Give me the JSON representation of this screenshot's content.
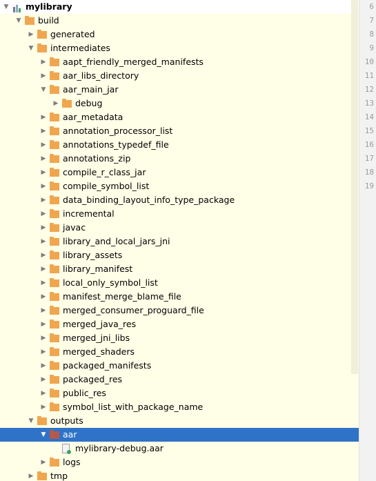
{
  "colors": {
    "tree_background": "#fffee7",
    "selection": "#2e73c8",
    "folder": "#f0a64f",
    "folder_selected": "#b5584d",
    "gutter": "#f2f2f2"
  },
  "gutter": {
    "line_numbers": [
      "6",
      "7",
      "8",
      "9",
      "10",
      "11",
      "12",
      "13",
      "14",
      "15",
      "16",
      "17",
      "18",
      "19"
    ]
  },
  "tree": [
    {
      "label": "mylibrary",
      "depth": 0,
      "expanded": true,
      "icon": "module-icon",
      "bold": true
    },
    {
      "label": "build",
      "depth": 1,
      "expanded": true,
      "icon": "folder-icon"
    },
    {
      "label": "generated",
      "depth": 2,
      "expanded": false,
      "icon": "folder-icon"
    },
    {
      "label": "intermediates",
      "depth": 2,
      "expanded": true,
      "icon": "folder-icon"
    },
    {
      "label": "aapt_friendly_merged_manifests",
      "depth": 3,
      "expanded": false,
      "icon": "folder-icon"
    },
    {
      "label": "aar_libs_directory",
      "depth": 3,
      "expanded": false,
      "icon": "folder-icon"
    },
    {
      "label": "aar_main_jar",
      "depth": 3,
      "expanded": true,
      "icon": "folder-icon"
    },
    {
      "label": "debug",
      "depth": 4,
      "expanded": false,
      "icon": "folder-icon"
    },
    {
      "label": "aar_metadata",
      "depth": 3,
      "expanded": false,
      "icon": "folder-icon"
    },
    {
      "label": "annotation_processor_list",
      "depth": 3,
      "expanded": false,
      "icon": "folder-icon"
    },
    {
      "label": "annotations_typedef_file",
      "depth": 3,
      "expanded": false,
      "icon": "folder-icon"
    },
    {
      "label": "annotations_zip",
      "depth": 3,
      "expanded": false,
      "icon": "folder-icon"
    },
    {
      "label": "compile_r_class_jar",
      "depth": 3,
      "expanded": false,
      "icon": "folder-icon"
    },
    {
      "label": "compile_symbol_list",
      "depth": 3,
      "expanded": false,
      "icon": "folder-icon"
    },
    {
      "label": "data_binding_layout_info_type_package",
      "depth": 3,
      "expanded": false,
      "icon": "folder-icon"
    },
    {
      "label": "incremental",
      "depth": 3,
      "expanded": false,
      "icon": "folder-icon"
    },
    {
      "label": "javac",
      "depth": 3,
      "expanded": false,
      "icon": "folder-icon"
    },
    {
      "label": "library_and_local_jars_jni",
      "depth": 3,
      "expanded": false,
      "icon": "folder-icon"
    },
    {
      "label": "library_assets",
      "depth": 3,
      "expanded": false,
      "icon": "folder-icon"
    },
    {
      "label": "library_manifest",
      "depth": 3,
      "expanded": false,
      "icon": "folder-icon"
    },
    {
      "label": "local_only_symbol_list",
      "depth": 3,
      "expanded": false,
      "icon": "folder-icon"
    },
    {
      "label": "manifest_merge_blame_file",
      "depth": 3,
      "expanded": false,
      "icon": "folder-icon"
    },
    {
      "label": "merged_consumer_proguard_file",
      "depth": 3,
      "expanded": false,
      "icon": "folder-icon"
    },
    {
      "label": "merged_java_res",
      "depth": 3,
      "expanded": false,
      "icon": "folder-icon"
    },
    {
      "label": "merged_jni_libs",
      "depth": 3,
      "expanded": false,
      "icon": "folder-icon"
    },
    {
      "label": "merged_shaders",
      "depth": 3,
      "expanded": false,
      "icon": "folder-icon"
    },
    {
      "label": "packaged_manifests",
      "depth": 3,
      "expanded": false,
      "icon": "folder-icon"
    },
    {
      "label": "packaged_res",
      "depth": 3,
      "expanded": false,
      "icon": "folder-icon"
    },
    {
      "label": "public_res",
      "depth": 3,
      "expanded": false,
      "icon": "folder-icon"
    },
    {
      "label": "symbol_list_with_package_name",
      "depth": 3,
      "expanded": false,
      "icon": "folder-icon"
    },
    {
      "label": "outputs",
      "depth": 2,
      "expanded": true,
      "icon": "folder-icon"
    },
    {
      "label": "aar",
      "depth": 3,
      "expanded": true,
      "icon": "folder-icon",
      "selected": true
    },
    {
      "label": "mylibrary-debug.aar",
      "depth": 4,
      "expanded": null,
      "icon": "aar-file-icon"
    },
    {
      "label": "logs",
      "depth": 3,
      "expanded": false,
      "icon": "folder-icon"
    },
    {
      "label": "tmp",
      "depth": 2,
      "expanded": false,
      "icon": "folder-icon"
    }
  ]
}
